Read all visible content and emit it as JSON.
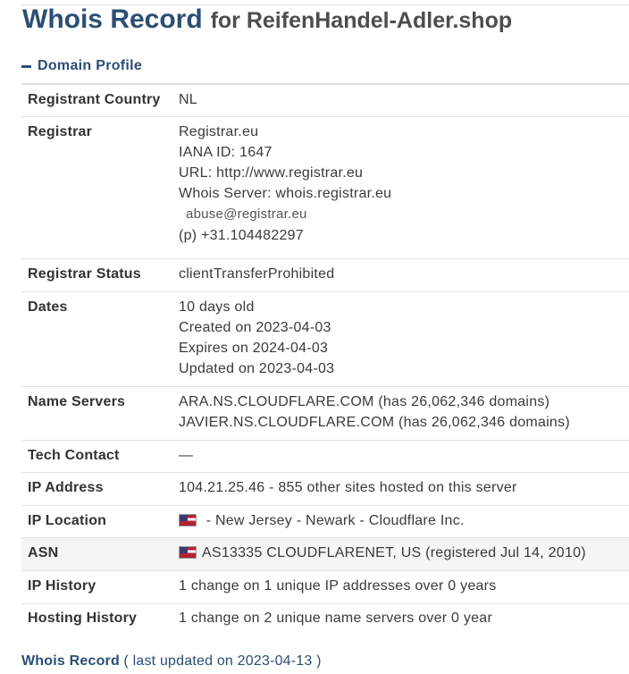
{
  "header": {
    "title": "Whois Record",
    "subtitle": "for ReifenHandel-Adler.shop"
  },
  "section": {
    "label": "Domain Profile"
  },
  "rows": {
    "registrant_country": {
      "label": "Registrant Country",
      "value": "NL"
    },
    "registrar": {
      "label": "Registrar",
      "name": "Registrar.eu",
      "iana": "IANA ID: 1647",
      "url": "URL: http://www.registrar.eu",
      "whois_server": "Whois Server: whois.registrar.eu",
      "email": "abuse@registrar.eu",
      "phone": "(p)  +31.104482297"
    },
    "registrar_status": {
      "label": "Registrar Status",
      "value": "clientTransferProhibited"
    },
    "dates": {
      "label": "Dates",
      "age": "10 days old",
      "created": "Created on 2023-04-03",
      "expires": "Expires on 2024-04-03",
      "updated": "Updated on 2023-04-03"
    },
    "name_servers": {
      "label": "Name Servers",
      "ns1": "ARA.NS.CLOUDFLARE.COM (has 26,062,346 domains)",
      "ns2": "JAVIER.NS.CLOUDFLARE.COM (has 26,062,346 domains)"
    },
    "tech_contact": {
      "label": "Tech Contact",
      "value": "—"
    },
    "ip_address": {
      "label": "IP Address",
      "value": "104.21.25.46 - 855 other sites hosted on this server"
    },
    "ip_location": {
      "label": "IP Location",
      "value": " - New Jersey - Newark - Cloudflare Inc.",
      "flag_icon": "us-flag-icon"
    },
    "asn": {
      "label": "ASN",
      "value": "AS13335 CLOUDFLARENET, US (registered Jul 14, 2010)",
      "flag_icon": "us-flag-icon"
    },
    "ip_history": {
      "label": "IP History",
      "value": "1 change on 1 unique IP addresses over 0 years"
    },
    "hosting_history": {
      "label": "Hosting History",
      "value": "1 change on 2 unique name servers over 0 year"
    }
  },
  "footer": {
    "title": "Whois Record",
    "updated": "( last updated on 2023-04-13 )"
  },
  "colors": {
    "heading_blue": "#2b4e74",
    "row_shade": "#f5f5f5",
    "divider": "#e3e3e3"
  }
}
